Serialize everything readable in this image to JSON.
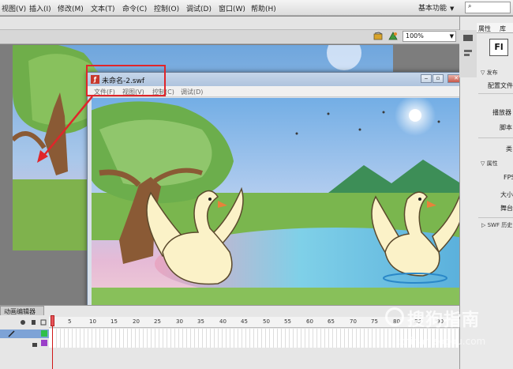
{
  "menu": {
    "items": [
      "视图(V)",
      "插入(I)",
      "修改(M)",
      "文本(T)",
      "命令(C)",
      "控制(O)",
      "调试(D)",
      "窗口(W)",
      "帮助(H)"
    ],
    "workspace": "基本功能"
  },
  "stage": {
    "zoom": "100%"
  },
  "swf_window": {
    "title": "未命名-2.swf",
    "menus": [
      "文件(F)",
      "视图(V)",
      "控制(C)",
      "调试(D)"
    ],
    "controls": [
      "▭",
      "▭",
      "✕"
    ]
  },
  "right_panel": {
    "tabs": [
      "属性",
      "库"
    ],
    "badge": "Fl",
    "section_publish": "发布",
    "publish_label": "配置文件",
    "player_label": "播放器",
    "script_label": "脚本",
    "class_label": "类",
    "section_props": "属性",
    "fps_label": "FPS",
    "size_label": "大小",
    "stage_label": "舞台",
    "section_swf": "SWF 历史"
  },
  "timeline": {
    "tab_label": "动画编辑器",
    "frame_numbers": [
      "5",
      "10",
      "15",
      "20",
      "25",
      "30",
      "35",
      "40",
      "45",
      "50",
      "55",
      "60",
      "65",
      "70",
      "75",
      "80",
      "85",
      "90"
    ]
  },
  "watermark": {
    "text": "搜狗指南",
    "url": "zhinan.sogou.com"
  },
  "colors": {
    "highlight": "#e0252a",
    "sky_top": "#7bb6e6",
    "grass": "#7fb24d",
    "lake": "#79c7e3"
  }
}
